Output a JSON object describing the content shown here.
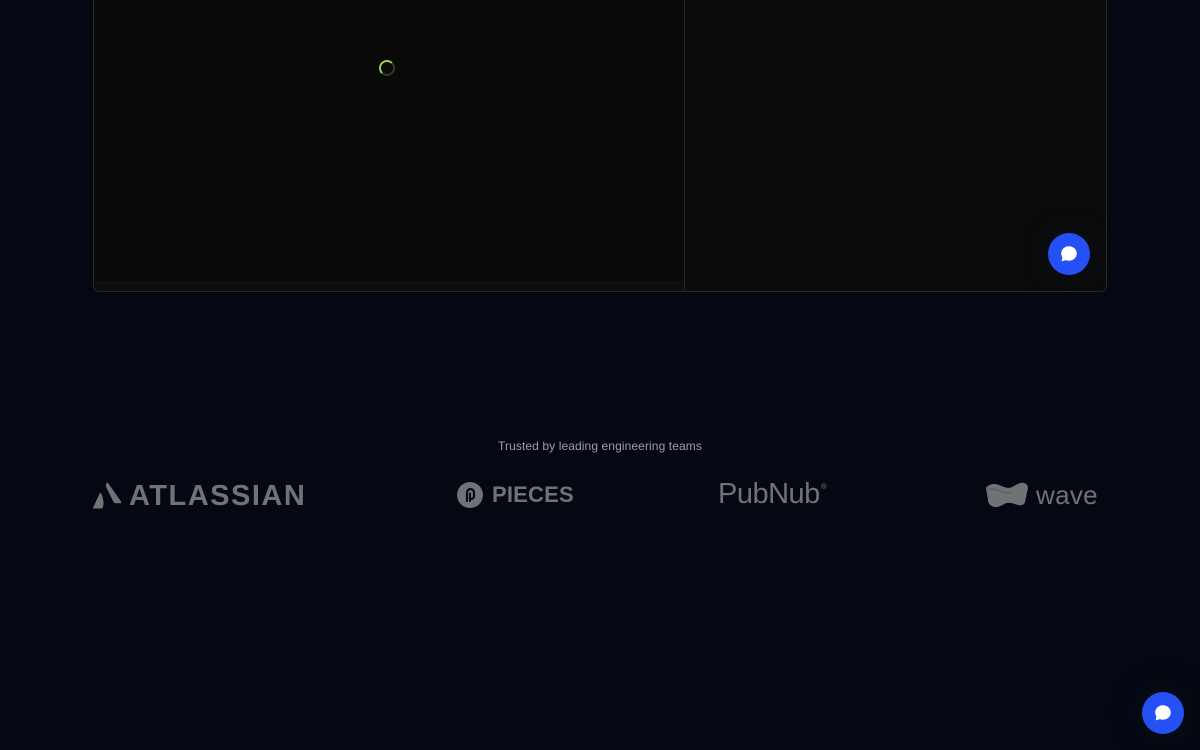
{
  "trusted": {
    "title": "Trusted by leading engineering teams",
    "logos": [
      {
        "name": "ATLASSIAN",
        "icon": "atlassian-triangle-icon"
      },
      {
        "name": "PIECES",
        "icon": "pieces-circle-icon"
      },
      {
        "name": "PubNub",
        "icon": "",
        "mark": "®"
      },
      {
        "name": "wave",
        "icon": "wave-mark-icon"
      }
    ]
  },
  "chat": {
    "icon": "chat-bubble-icon",
    "color": "#2550F5"
  },
  "demo": {
    "loading_icon": "loading-spinner-icon",
    "spinner_color": "#9CCF4A"
  }
}
